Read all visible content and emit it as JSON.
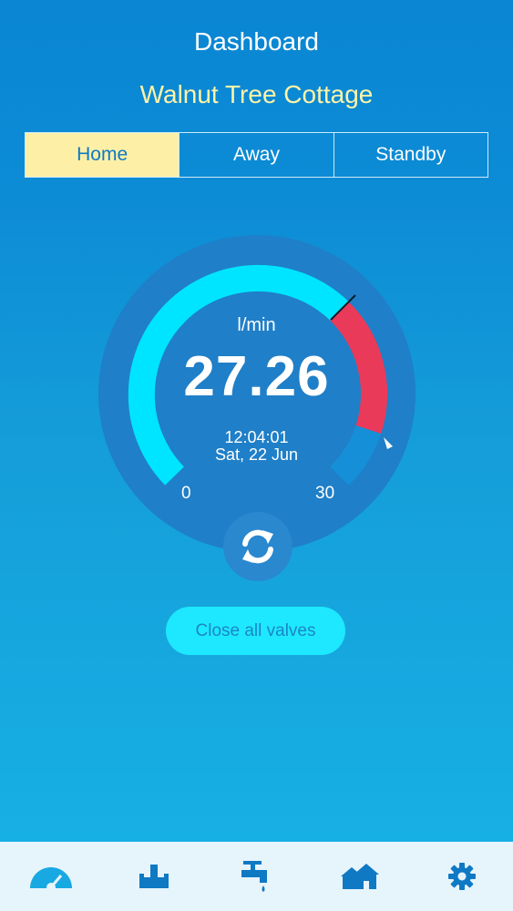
{
  "header": {
    "title": "Dashboard",
    "property_name": "Walnut Tree Cottage"
  },
  "modes": [
    {
      "label": "Home",
      "active": true
    },
    {
      "label": "Away",
      "active": false
    },
    {
      "label": "Standby",
      "active": false
    }
  ],
  "gauge": {
    "unit": "l/min",
    "value": "27.26",
    "time": "12:04:01",
    "date": "Sat, 22 Jun",
    "min_label": "0",
    "max_label": "30",
    "colors": {
      "normal": "#00e5ff",
      "alert": "#ea3a5a",
      "track": "#2a88cf"
    }
  },
  "actions": {
    "close_valves_label": "Close all valves"
  },
  "tabbar": {
    "items": [
      {
        "icon": "gauge-icon",
        "active": true
      },
      {
        "icon": "valve-icon",
        "active": false
      },
      {
        "icon": "tap-icon",
        "active": false
      },
      {
        "icon": "houses-icon",
        "active": false
      },
      {
        "icon": "gear-icon",
        "active": false
      }
    ]
  }
}
